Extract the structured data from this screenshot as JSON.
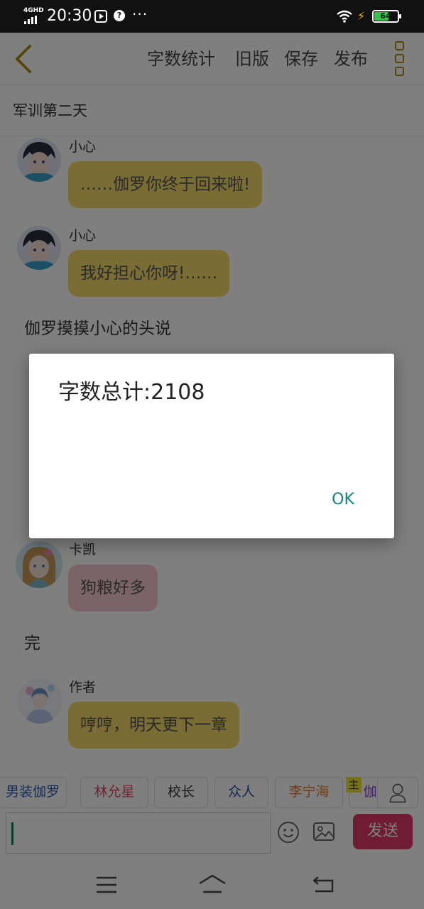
{
  "status_bar": {
    "network": "4GHD",
    "time": "20:30",
    "more": "···",
    "battery": "64",
    "battery_fraction": 0.64
  },
  "toolbar": {
    "actions": [
      "字数统计",
      "旧版",
      "保存",
      "发布"
    ]
  },
  "chapter": {
    "title": "军训第二天"
  },
  "messages": [
    {
      "type": "bubble",
      "sender": "小心",
      "text": "……伽罗你终于回来啦!",
      "avatar": "boy-avatar",
      "bubble_color": "#f5d96b"
    },
    {
      "type": "bubble",
      "sender": "小心",
      "text": "我好担心你呀!……",
      "avatar": "boy-avatar",
      "bubble_color": "#f5d96b"
    },
    {
      "type": "narration",
      "text": "伽罗摸摸小心的头说"
    },
    {
      "type": "bubble",
      "sender": "卡凯",
      "text": "狗粮好多",
      "avatar": "girl-avatar",
      "bubble_color": "#f4c8d4"
    },
    {
      "type": "narration",
      "text": "完"
    },
    {
      "type": "bubble",
      "sender": "作者",
      "text": "哼哼，明天更下一章",
      "avatar": "author-avatar",
      "bubble_color": "#f5d96b"
    }
  ],
  "characters": [
    {
      "name": "男装伽罗",
      "color": "#2b5aa8"
    },
    {
      "name": "林允星",
      "color": "#d9486c"
    },
    {
      "name": "校长",
      "color": "#333333"
    },
    {
      "name": "众人",
      "color": "#2b4fa0"
    },
    {
      "name": "李宁海",
      "color": "#e07a2e"
    },
    {
      "name": "伽",
      "color": "#8e44c9"
    }
  ],
  "main_tag": "主",
  "input": {
    "value": "",
    "send_label": "发送"
  },
  "dialog": {
    "message": "字数总计:2108",
    "ok_label": "OK"
  },
  "colors": {
    "accent_send": "#e0386b",
    "accent_ok": "#14857c",
    "toolbar_icon": "#a88d10"
  }
}
